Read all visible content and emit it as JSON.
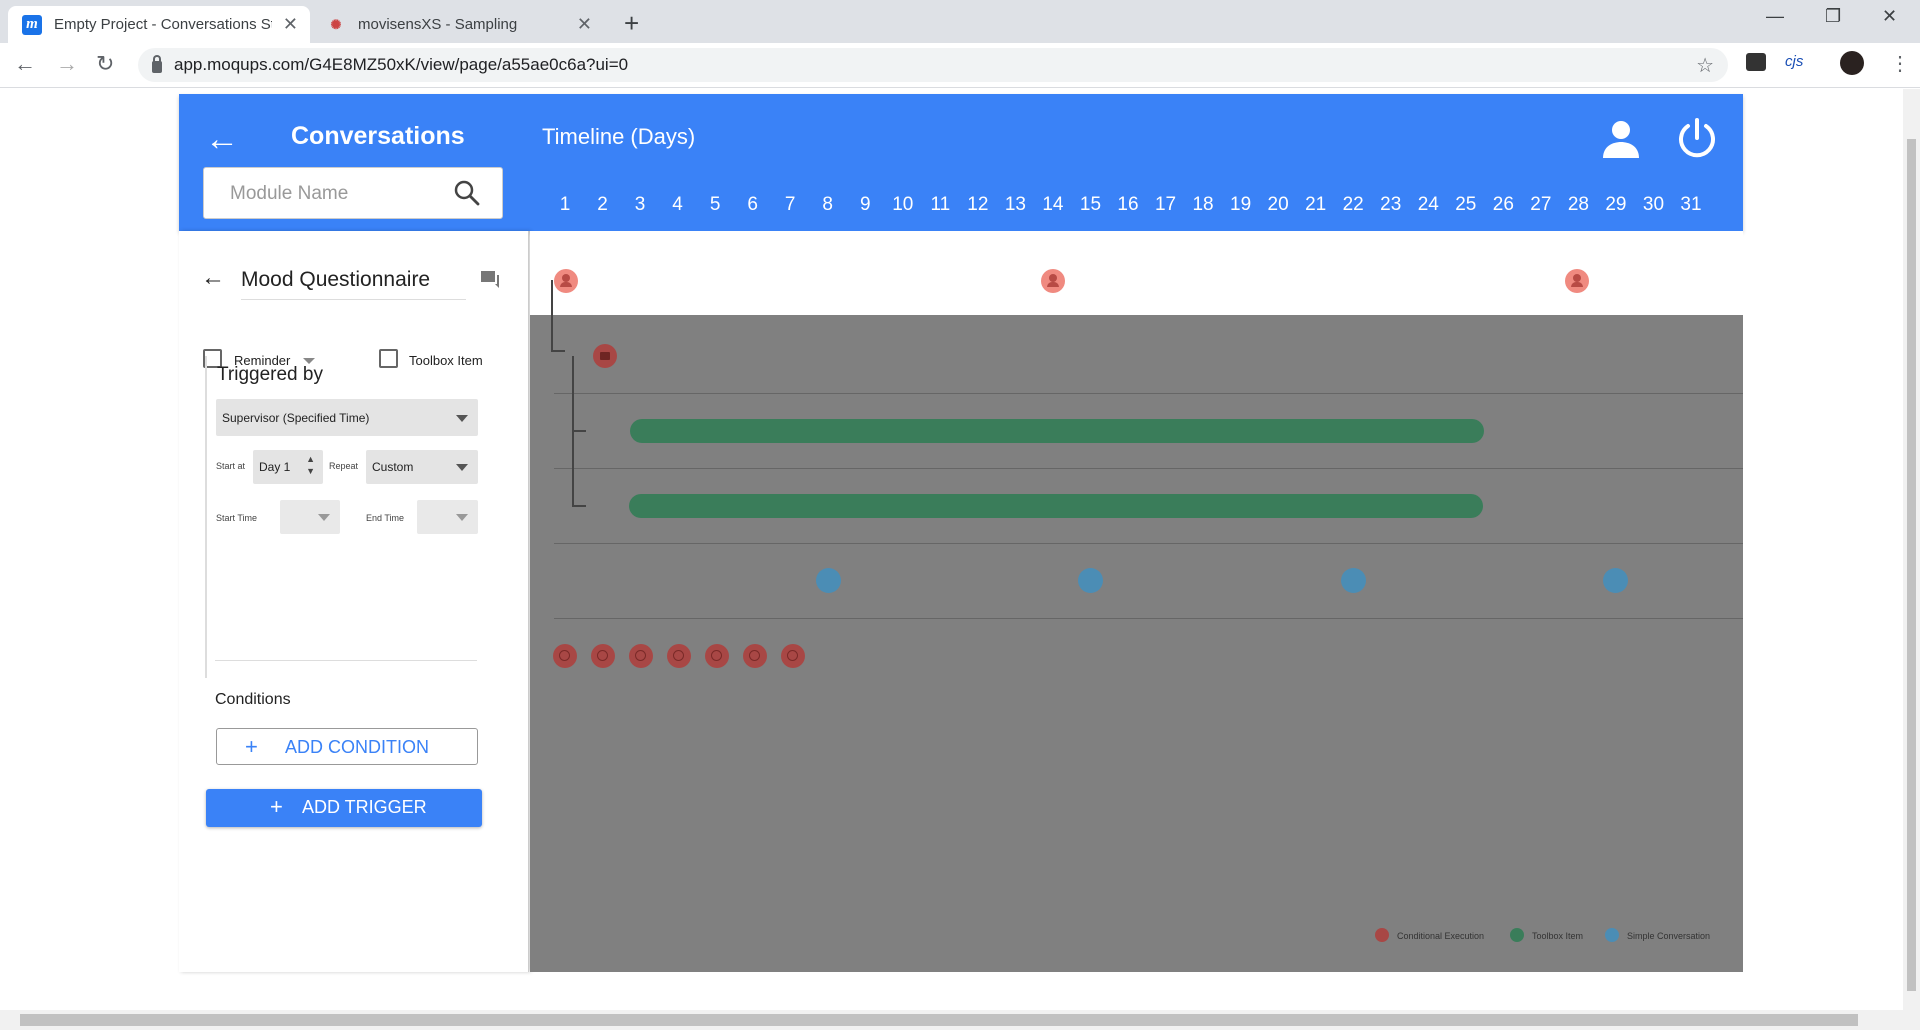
{
  "browser": {
    "tabs": [
      {
        "title": "Empty Project - Conversations St",
        "favicon": "m",
        "active": true
      },
      {
        "title": "movisensXS - Sampling",
        "favicon": "movisens-icon",
        "active": false
      }
    ],
    "url": "app.moqups.com/G4E8MZ50xK/view/page/a55ae0c6a?ui=0",
    "ext_label": "cjs"
  },
  "app": {
    "title": "Conversations",
    "timeline_title": "Timeline (Days)",
    "search_placeholder": "Module Name",
    "days": [
      "1",
      "2",
      "3",
      "4",
      "5",
      "6",
      "7",
      "8",
      "9",
      "10",
      "11",
      "12",
      "13",
      "14",
      "15",
      "16",
      "17",
      "18",
      "19",
      "20",
      "21",
      "22",
      "23",
      "24",
      "25",
      "26",
      "27",
      "28",
      "29",
      "30",
      "31"
    ],
    "accent": "#3a82f7"
  },
  "panel": {
    "title": "Mood Questionnaire",
    "reminder_label": "Reminder",
    "toolbox_label": "Toolbox Item",
    "triggered_by_label": "Triggered by",
    "trigger_select": "Supervisor (Specified Time)",
    "start_at_label": "Start at",
    "start_at_value": "Day 1",
    "repeat_label": "Repeat",
    "repeat_value": "Custom",
    "start_time_label": "Start Time",
    "end_time_label": "End Time",
    "conditions_label": "Conditions",
    "add_condition": "ADD CONDITION",
    "add_trigger": "ADD TRIGGER"
  },
  "legend": [
    {
      "label": "Conditional Execution",
      "color": "#a84745"
    },
    {
      "label": "Toolbox Item",
      "color": "#3a7d5a"
    },
    {
      "label": "Simple Conversation",
      "color": "#4b8db5"
    }
  ]
}
